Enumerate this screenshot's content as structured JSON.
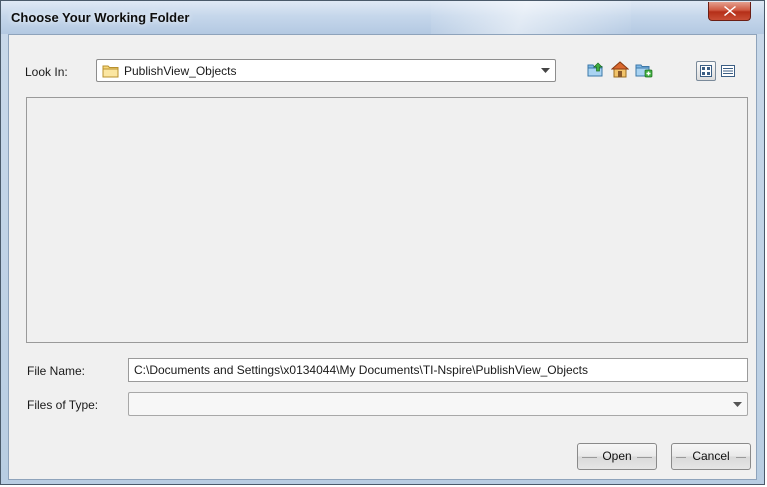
{
  "window": {
    "title": "Choose Your Working Folder"
  },
  "look_in": {
    "label": "Look In:",
    "value": "PublishView_Objects"
  },
  "toolbar": {
    "icons": [
      "up-one-level-icon",
      "home-icon",
      "new-folder-icon",
      "list-view-icon",
      "details-view-icon"
    ],
    "active_view": "list"
  },
  "file_name": {
    "label": "File Name:",
    "value": "C:\\Documents and Settings\\x0134044\\My Documents\\TI-Nspire\\PublishView_Objects"
  },
  "files_of_type": {
    "label": "Files of Type:",
    "value": ""
  },
  "buttons": {
    "open": "Open",
    "cancel": "Cancel"
  }
}
